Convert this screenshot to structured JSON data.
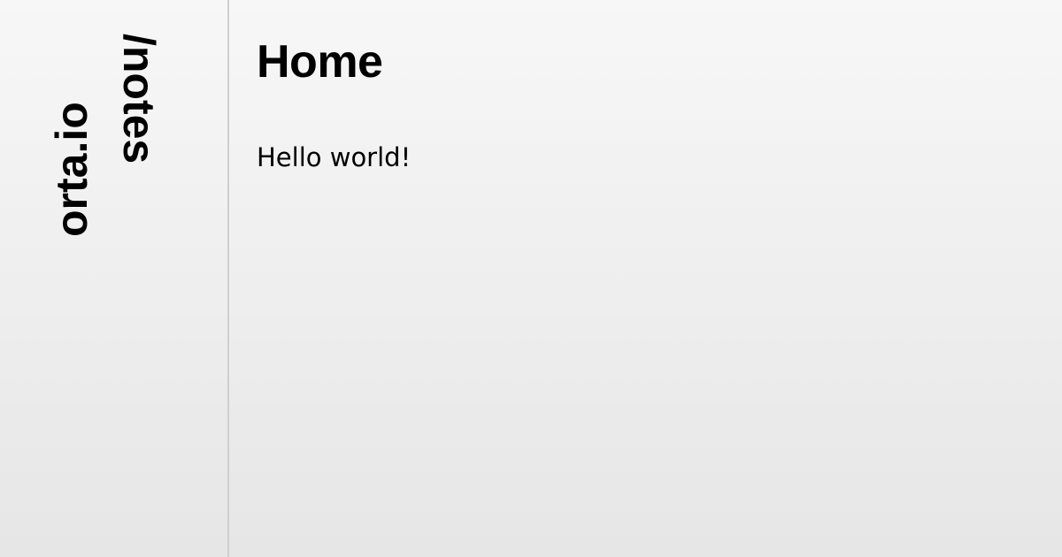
{
  "sidebar": {
    "domain": "orta.io",
    "path": "/notes"
  },
  "main": {
    "title": "Home",
    "body": "Hello world!"
  },
  "colors": {
    "background_top": "#f7f7f7",
    "background_bottom": "#e6e6e6",
    "divider": "#cfcfcf",
    "text": "#000000"
  }
}
